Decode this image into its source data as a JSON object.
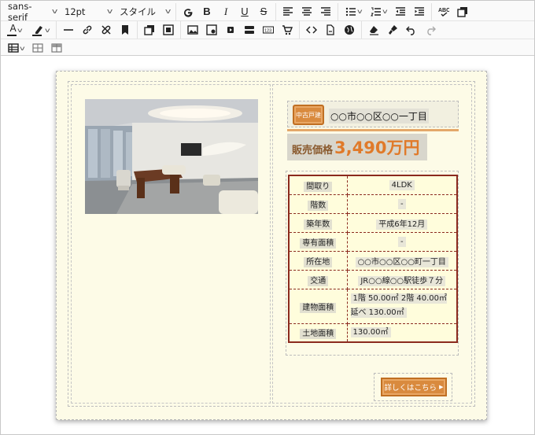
{
  "toolbar": {
    "font_family": "sans-serif",
    "font_size": "12pt",
    "style": "スタイル"
  },
  "property": {
    "badge": "中古戸建",
    "address_title": "○○市○○区○○一丁目",
    "price_label": "販売価格",
    "price_value": "3,490万円",
    "details_button": "詳しくはこちら",
    "specs": [
      {
        "key": "間取り",
        "value": "4LDK"
      },
      {
        "key": "階数",
        "value": "-"
      },
      {
        "key": "築年数",
        "value": "平成6年12月"
      },
      {
        "key": "専有面積",
        "value": "-"
      },
      {
        "key": "所在地",
        "value": "○○市○○区○○町一丁目"
      },
      {
        "key": "交通",
        "value": "JR○○線○○駅徒歩７分"
      },
      {
        "key": "建物面積",
        "value": "1階 50.00㎡ 2階 40.00㎡ 延べ 130.00㎡"
      },
      {
        "key": "土地面積",
        "value": "130.00㎡"
      }
    ]
  },
  "colors": {
    "accent_orange": "#d98a3e",
    "price_orange": "#e07a2a",
    "table_border": "#8b2a1e",
    "sheet_bg": "#fdfbe7"
  }
}
